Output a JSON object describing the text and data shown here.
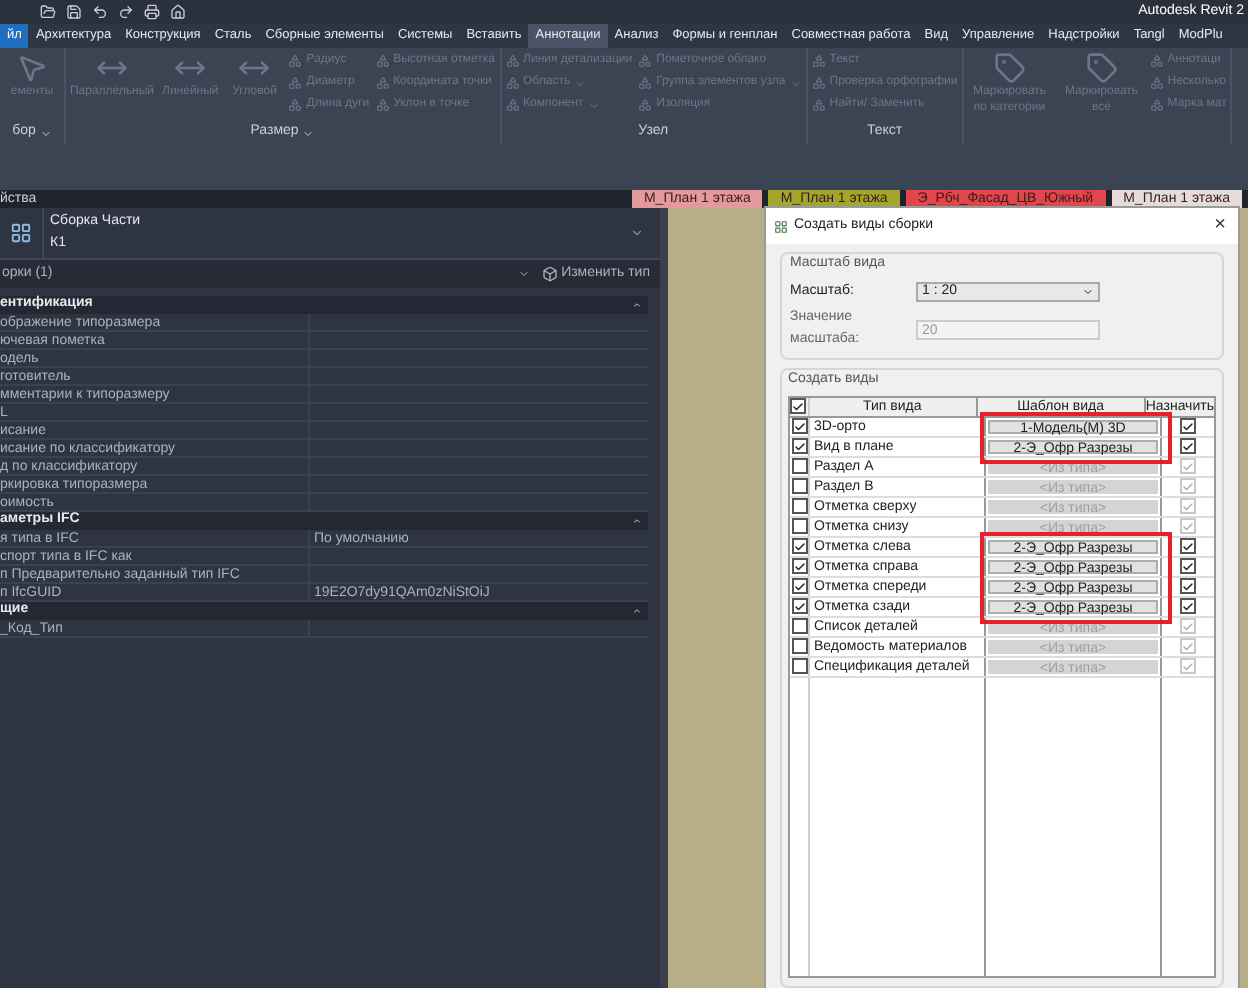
{
  "app_title": "Autodesk Revit 2",
  "ribbon_tabs": [
    {
      "label": "йл",
      "selected": false,
      "kind": "file"
    },
    {
      "label": "Архитектура",
      "selected": false,
      "kind": "tab"
    },
    {
      "label": "Конструкция",
      "selected": false,
      "kind": "tab"
    },
    {
      "label": "Сталь",
      "selected": false,
      "kind": "tab"
    },
    {
      "label": "Сборные элементы",
      "selected": false,
      "kind": "tab"
    },
    {
      "label": "Системы",
      "selected": false,
      "kind": "tab"
    },
    {
      "label": "Вставить",
      "selected": false,
      "kind": "tab"
    },
    {
      "label": "Аннотации",
      "selected": true,
      "kind": "tab"
    },
    {
      "label": "Анализ",
      "selected": false,
      "kind": "tab"
    },
    {
      "label": "Формы и генплан",
      "selected": false,
      "kind": "tab"
    },
    {
      "label": "Совместная работа",
      "selected": false,
      "kind": "tab"
    },
    {
      "label": "Вид",
      "selected": false,
      "kind": "tab"
    },
    {
      "label": "Управление",
      "selected": false,
      "kind": "tab"
    },
    {
      "label": "Надстройки",
      "selected": false,
      "kind": "tab"
    },
    {
      "label": "Tangl",
      "selected": false,
      "kind": "tab"
    },
    {
      "label": "ModPlu",
      "selected": false,
      "kind": "tab"
    }
  ],
  "ribbon_panels": [
    {
      "label": "бор",
      "dropdown": true,
      "groups": [
        {
          "kind": "large",
          "items": [
            {
              "label": "ементы"
            }
          ]
        }
      ]
    },
    {
      "label": "Размер",
      "dropdown": true,
      "groups": [
        {
          "kind": "large",
          "items": [
            {
              "label": "Параллельный"
            },
            {
              "label": "Линейный"
            },
            {
              "label": "Угловой"
            }
          ]
        },
        {
          "kind": "column",
          "items": [
            {
              "label": "Радиус"
            },
            {
              "label": "Диаметр"
            },
            {
              "label": "Длина дуги"
            }
          ]
        },
        {
          "kind": "column",
          "items": [
            {
              "label": "Высотная отметка"
            },
            {
              "label": "Координата точки"
            },
            {
              "label": "Уклон в точке"
            }
          ]
        }
      ]
    },
    {
      "label": "Узел",
      "groups": [
        {
          "kind": "column",
          "items": [
            {
              "label": "Линия детализации"
            },
            {
              "label": "Область",
              "dropdown": true
            },
            {
              "label": "Компонент",
              "dropdown": true
            }
          ]
        },
        {
          "kind": "column",
          "items": [
            {
              "label": "Пометочное облако"
            },
            {
              "label": "Группа элементов узла",
              "dropdown": true
            },
            {
              "label": "Изоляция"
            }
          ]
        }
      ]
    },
    {
      "label": "Текст",
      "groups": [
        {
          "kind": "column",
          "items": [
            {
              "label": "Текст"
            },
            {
              "label": "Проверка орфографии"
            },
            {
              "label": "Найти/ Заменить"
            }
          ]
        }
      ]
    },
    {
      "groups": [
        {
          "kind": "large",
          "items": [
            {
              "label": "Маркировать по категории"
            },
            {
              "label": "Маркировать все"
            }
          ]
        },
        {
          "kind": "column",
          "items": [
            {
              "label": "Аннотаци"
            },
            {
              "label": "Несколько"
            },
            {
              "label": "Марка мат"
            }
          ]
        }
      ]
    }
  ],
  "properties": {
    "title": "йства",
    "type_name": "Сборка Части",
    "type_value": "К1",
    "filter": "орки (1)",
    "edit_type": "Изменить тип",
    "groups": [
      {
        "label": "ентификация",
        "rows": [
          {
            "name": "ображение типоразмера"
          },
          {
            "name": "ючевая пометка"
          },
          {
            "name": "одель"
          },
          {
            "name": "готовитель"
          },
          {
            "name": "мментарии к типоразмеру"
          },
          {
            "name": "L"
          },
          {
            "name": "исание"
          },
          {
            "name": "исание по классификатору"
          },
          {
            "name": "д по классификатору"
          },
          {
            "name": "ркировка типоразмера"
          },
          {
            "name": "оимость"
          }
        ]
      },
      {
        "label": "аметры IFC",
        "rows": [
          {
            "name": "я типа в IFC",
            "value": "По умолчанию"
          },
          {
            "name": "спорт типа в IFC как"
          },
          {
            "name": "п Предварительно заданный тип IFC"
          },
          {
            "name": "п IfcGUID",
            "value": "19E2O7dy91QAm0zNiStOiJ"
          }
        ]
      },
      {
        "label": "щие",
        "rows": [
          {
            "name": "_Код_Тип"
          }
        ]
      }
    ]
  },
  "view_tabs": [
    {
      "label": "М_План 1 этажа",
      "color": "#e49a9a"
    },
    {
      "label": "М_План 1 этажа",
      "color": "#a3a52c"
    },
    {
      "label": "Э_Рбч_Фасад_ЦВ_Южный",
      "color": "#e0474c"
    },
    {
      "label": "М_План 1 этажа",
      "color": "#e6dcdc"
    }
  ],
  "dialog": {
    "title": "Создать виды сборки",
    "close": "×",
    "scale_group": "Масштаб вида",
    "scale_label": "Масштаб:",
    "scale_value": "1 : 20",
    "scale_number_label": "Значение масштаба:",
    "scale_number": "20",
    "views_group": "Создать виды",
    "all_checked": true,
    "columns": [
      "Тип вида",
      "Шаблон вида",
      "Назначить"
    ],
    "rows": [
      {
        "label": "3D-орто",
        "checked": true,
        "template": "1-Модель(М) 3D",
        "assign": true,
        "highlighted": true
      },
      {
        "label": "Вид в плане",
        "checked": true,
        "template": "2-Э_Офр Разрезы",
        "assign": true,
        "highlighted": true
      },
      {
        "label": "Раздел А",
        "checked": false,
        "template": "<Из типа>",
        "assign": true,
        "highlighted": false
      },
      {
        "label": "Раздел В",
        "checked": false,
        "template": "<Из типа>",
        "assign": true,
        "highlighted": false
      },
      {
        "label": "Отметка сверху",
        "checked": false,
        "template": "<Из типа>",
        "assign": true,
        "highlighted": false
      },
      {
        "label": "Отметка снизу",
        "checked": false,
        "template": "<Из типа>",
        "assign": true,
        "highlighted": false
      },
      {
        "label": "Отметка слева",
        "checked": true,
        "template": "2-Э_Офр Разрезы",
        "assign": true,
        "highlighted": true
      },
      {
        "label": "Отметка справа",
        "checked": true,
        "template": "2-Э_Офр Разрезы",
        "assign": true,
        "highlighted": true
      },
      {
        "label": "Отметка спереди",
        "checked": true,
        "template": "2-Э_Офр Разрезы",
        "assign": true,
        "highlighted": true
      },
      {
        "label": "Отметка сзади",
        "checked": true,
        "template": "2-Э_Офр Разрезы",
        "assign": true,
        "highlighted": true
      },
      {
        "label": "Список деталей",
        "checked": false,
        "template": "<Из типа>",
        "assign": true,
        "highlighted": false
      },
      {
        "label": "Ведомость материалов",
        "checked": false,
        "template": "<Из типа>",
        "assign": true,
        "highlighted": false
      },
      {
        "label": "Спецификация деталей",
        "checked": false,
        "template": "<Из типа>",
        "assign": true,
        "highlighted": false
      }
    ]
  }
}
